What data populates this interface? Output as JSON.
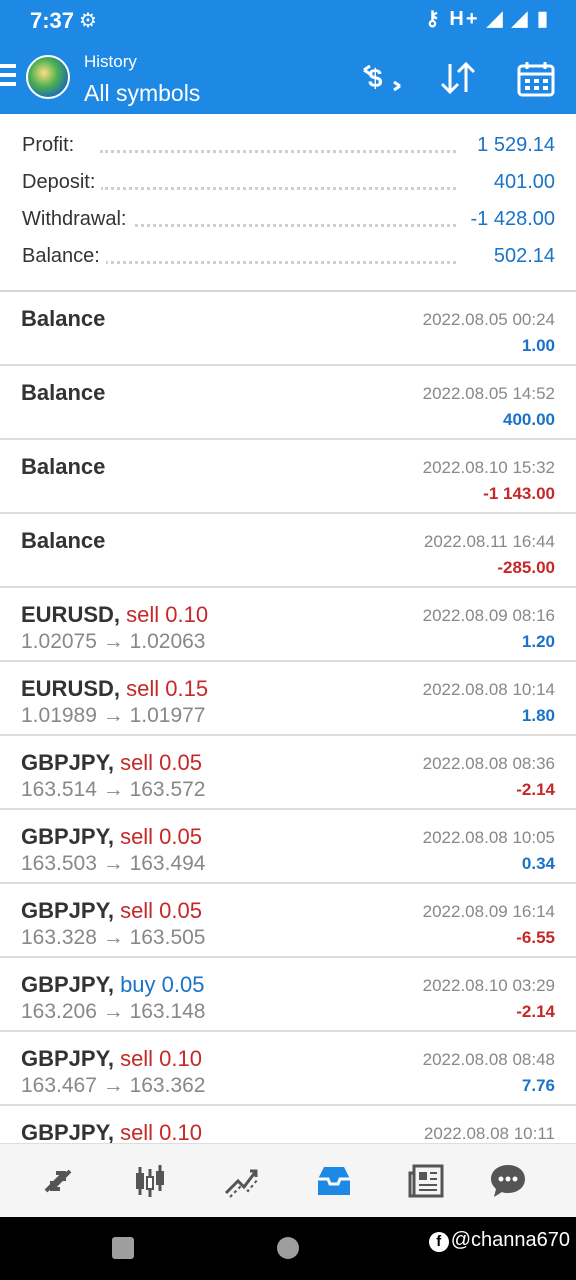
{
  "status_bar": {
    "time": "7:37",
    "signal_text": "H+"
  },
  "app_bar": {
    "subtitle": "History",
    "title": "All symbols",
    "actions": [
      "deposit-withdraw-icon",
      "sort-icon",
      "calendar-icon"
    ]
  },
  "summary": [
    {
      "label": "Profit:",
      "value": "1 529.14"
    },
    {
      "label": "Deposit:",
      "value": "401.00"
    },
    {
      "label": "Withdrawal:",
      "value": "-1 428.00"
    },
    {
      "label": "Balance:",
      "value": "502.14"
    }
  ],
  "deals": [
    {
      "symbol": "Balance",
      "type": "",
      "prices": "",
      "date": "2022.08.05 00:24",
      "profit": "1.00",
      "sign": "pos"
    },
    {
      "symbol": "Balance",
      "type": "",
      "prices": "",
      "date": "2022.08.05 14:52",
      "profit": "400.00",
      "sign": "pos"
    },
    {
      "symbol": "Balance",
      "type": "",
      "prices": "",
      "date": "2022.08.10 15:32",
      "profit": "-1 143.00",
      "sign": "neg"
    },
    {
      "symbol": "Balance",
      "type": "",
      "prices": "",
      "date": "2022.08.11 16:44",
      "profit": "-285.00",
      "sign": "neg"
    },
    {
      "symbol": "EURUSD,",
      "type": "sell 0.10",
      "side": "sell",
      "prices": "1.02075 → 1.02063",
      "date": "2022.08.09 08:16",
      "profit": "1.20",
      "sign": "pos"
    },
    {
      "symbol": "EURUSD,",
      "type": "sell 0.15",
      "side": "sell",
      "prices": "1.01989 → 1.01977",
      "date": "2022.08.08 10:14",
      "profit": "1.80",
      "sign": "pos"
    },
    {
      "symbol": "GBPJPY,",
      "type": "sell 0.05",
      "side": "sell",
      "prices": "163.514 → 163.572",
      "date": "2022.08.08 08:36",
      "profit": "-2.14",
      "sign": "neg"
    },
    {
      "symbol": "GBPJPY,",
      "type": "sell 0.05",
      "side": "sell",
      "prices": "163.503 → 163.494",
      "date": "2022.08.08 10:05",
      "profit": "0.34",
      "sign": "pos"
    },
    {
      "symbol": "GBPJPY,",
      "type": "sell 0.05",
      "side": "sell",
      "prices": "163.328 → 163.505",
      "date": "2022.08.09 16:14",
      "profit": "-6.55",
      "sign": "neg"
    },
    {
      "symbol": "GBPJPY,",
      "type": "buy 0.05",
      "side": "buy",
      "prices": "163.206 → 163.148",
      "date": "2022.08.10 03:29",
      "profit": "-2.14",
      "sign": "neg"
    },
    {
      "symbol": "GBPJPY,",
      "type": "sell 0.10",
      "side": "sell",
      "prices": "163.467 → 163.362",
      "date": "2022.08.08 08:48",
      "profit": "7.76",
      "sign": "pos"
    },
    {
      "symbol": "GBPJPY,",
      "type": "sell 0.10",
      "side": "sell",
      "prices": "",
      "date": "2022.08.08 10:11",
      "profit": "",
      "sign": "pos"
    }
  ],
  "bottom_nav": [
    {
      "name": "quotes-icon",
      "active": false
    },
    {
      "name": "chart-icon",
      "active": false
    },
    {
      "name": "trade-icon",
      "active": false
    },
    {
      "name": "history-icon",
      "active": true
    },
    {
      "name": "news-icon",
      "active": false
    },
    {
      "name": "chat-icon",
      "active": false
    }
  ],
  "watermark": "@channa670",
  "colors": {
    "primary": "#1e88e5",
    "positive": "#1a73c8",
    "negative": "#c62828"
  }
}
